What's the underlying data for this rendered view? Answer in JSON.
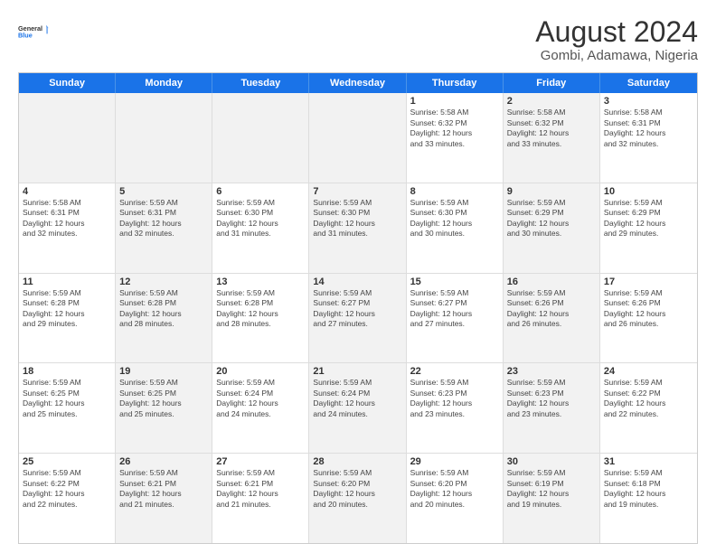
{
  "logo": {
    "line1": "General",
    "line2": "Blue"
  },
  "title": "August 2024",
  "subtitle": "Gombi, Adamawa, Nigeria",
  "weekdays": [
    "Sunday",
    "Monday",
    "Tuesday",
    "Wednesday",
    "Thursday",
    "Friday",
    "Saturday"
  ],
  "rows": [
    [
      {
        "day": "",
        "info": "",
        "shaded": true
      },
      {
        "day": "",
        "info": "",
        "shaded": true
      },
      {
        "day": "",
        "info": "",
        "shaded": true
      },
      {
        "day": "",
        "info": "",
        "shaded": true
      },
      {
        "day": "1",
        "info": "Sunrise: 5:58 AM\nSunset: 6:32 PM\nDaylight: 12 hours\nand 33 minutes.",
        "shaded": false
      },
      {
        "day": "2",
        "info": "Sunrise: 5:58 AM\nSunset: 6:32 PM\nDaylight: 12 hours\nand 33 minutes.",
        "shaded": true
      },
      {
        "day": "3",
        "info": "Sunrise: 5:58 AM\nSunset: 6:31 PM\nDaylight: 12 hours\nand 32 minutes.",
        "shaded": false
      }
    ],
    [
      {
        "day": "4",
        "info": "Sunrise: 5:58 AM\nSunset: 6:31 PM\nDaylight: 12 hours\nand 32 minutes.",
        "shaded": false
      },
      {
        "day": "5",
        "info": "Sunrise: 5:59 AM\nSunset: 6:31 PM\nDaylight: 12 hours\nand 32 minutes.",
        "shaded": true
      },
      {
        "day": "6",
        "info": "Sunrise: 5:59 AM\nSunset: 6:30 PM\nDaylight: 12 hours\nand 31 minutes.",
        "shaded": false
      },
      {
        "day": "7",
        "info": "Sunrise: 5:59 AM\nSunset: 6:30 PM\nDaylight: 12 hours\nand 31 minutes.",
        "shaded": true
      },
      {
        "day": "8",
        "info": "Sunrise: 5:59 AM\nSunset: 6:30 PM\nDaylight: 12 hours\nand 30 minutes.",
        "shaded": false
      },
      {
        "day": "9",
        "info": "Sunrise: 5:59 AM\nSunset: 6:29 PM\nDaylight: 12 hours\nand 30 minutes.",
        "shaded": true
      },
      {
        "day": "10",
        "info": "Sunrise: 5:59 AM\nSunset: 6:29 PM\nDaylight: 12 hours\nand 29 minutes.",
        "shaded": false
      }
    ],
    [
      {
        "day": "11",
        "info": "Sunrise: 5:59 AM\nSunset: 6:28 PM\nDaylight: 12 hours\nand 29 minutes.",
        "shaded": false
      },
      {
        "day": "12",
        "info": "Sunrise: 5:59 AM\nSunset: 6:28 PM\nDaylight: 12 hours\nand 28 minutes.",
        "shaded": true
      },
      {
        "day": "13",
        "info": "Sunrise: 5:59 AM\nSunset: 6:28 PM\nDaylight: 12 hours\nand 28 minutes.",
        "shaded": false
      },
      {
        "day": "14",
        "info": "Sunrise: 5:59 AM\nSunset: 6:27 PM\nDaylight: 12 hours\nand 27 minutes.",
        "shaded": true
      },
      {
        "day": "15",
        "info": "Sunrise: 5:59 AM\nSunset: 6:27 PM\nDaylight: 12 hours\nand 27 minutes.",
        "shaded": false
      },
      {
        "day": "16",
        "info": "Sunrise: 5:59 AM\nSunset: 6:26 PM\nDaylight: 12 hours\nand 26 minutes.",
        "shaded": true
      },
      {
        "day": "17",
        "info": "Sunrise: 5:59 AM\nSunset: 6:26 PM\nDaylight: 12 hours\nand 26 minutes.",
        "shaded": false
      }
    ],
    [
      {
        "day": "18",
        "info": "Sunrise: 5:59 AM\nSunset: 6:25 PM\nDaylight: 12 hours\nand 25 minutes.",
        "shaded": false
      },
      {
        "day": "19",
        "info": "Sunrise: 5:59 AM\nSunset: 6:25 PM\nDaylight: 12 hours\nand 25 minutes.",
        "shaded": true
      },
      {
        "day": "20",
        "info": "Sunrise: 5:59 AM\nSunset: 6:24 PM\nDaylight: 12 hours\nand 24 minutes.",
        "shaded": false
      },
      {
        "day": "21",
        "info": "Sunrise: 5:59 AM\nSunset: 6:24 PM\nDaylight: 12 hours\nand 24 minutes.",
        "shaded": true
      },
      {
        "day": "22",
        "info": "Sunrise: 5:59 AM\nSunset: 6:23 PM\nDaylight: 12 hours\nand 23 minutes.",
        "shaded": false
      },
      {
        "day": "23",
        "info": "Sunrise: 5:59 AM\nSunset: 6:23 PM\nDaylight: 12 hours\nand 23 minutes.",
        "shaded": true
      },
      {
        "day": "24",
        "info": "Sunrise: 5:59 AM\nSunset: 6:22 PM\nDaylight: 12 hours\nand 22 minutes.",
        "shaded": false
      }
    ],
    [
      {
        "day": "25",
        "info": "Sunrise: 5:59 AM\nSunset: 6:22 PM\nDaylight: 12 hours\nand 22 minutes.",
        "shaded": false
      },
      {
        "day": "26",
        "info": "Sunrise: 5:59 AM\nSunset: 6:21 PM\nDaylight: 12 hours\nand 21 minutes.",
        "shaded": true
      },
      {
        "day": "27",
        "info": "Sunrise: 5:59 AM\nSunset: 6:21 PM\nDaylight: 12 hours\nand 21 minutes.",
        "shaded": false
      },
      {
        "day": "28",
        "info": "Sunrise: 5:59 AM\nSunset: 6:20 PM\nDaylight: 12 hours\nand 20 minutes.",
        "shaded": true
      },
      {
        "day": "29",
        "info": "Sunrise: 5:59 AM\nSunset: 6:20 PM\nDaylight: 12 hours\nand 20 minutes.",
        "shaded": false
      },
      {
        "day": "30",
        "info": "Sunrise: 5:59 AM\nSunset: 6:19 PM\nDaylight: 12 hours\nand 19 minutes.",
        "shaded": true
      },
      {
        "day": "31",
        "info": "Sunrise: 5:59 AM\nSunset: 6:18 PM\nDaylight: 12 hours\nand 19 minutes.",
        "shaded": false
      }
    ]
  ]
}
